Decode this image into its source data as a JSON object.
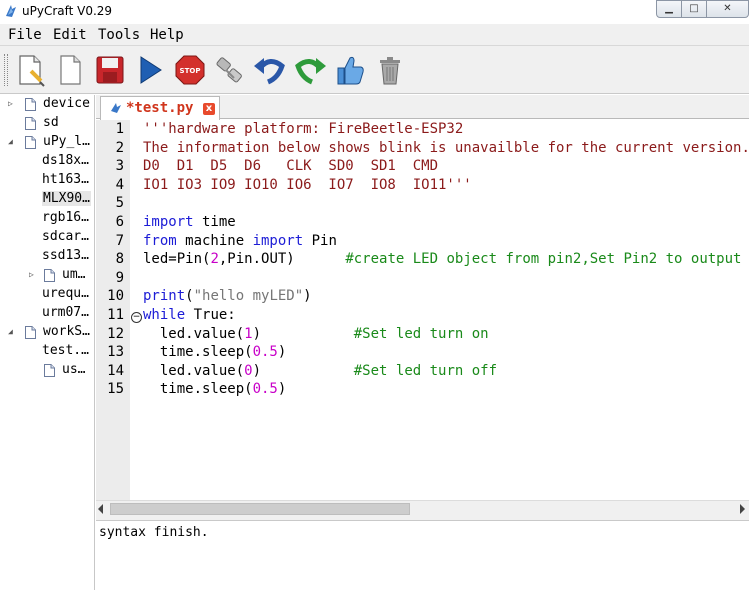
{
  "window": {
    "title": "uPyCraft V0.29",
    "controls": {
      "minimize": "▁",
      "maximize": "□",
      "close": "✕"
    }
  },
  "menu": {
    "items": [
      "File",
      "Edit",
      "Tools",
      "Help"
    ]
  },
  "toolbar": {
    "icons": [
      "new-file-icon",
      "open-file-icon",
      "save-icon",
      "run-icon",
      "stop-icon",
      "connect-icon",
      "undo-icon",
      "redo-icon",
      "syntax-check-icon",
      "clear-icon"
    ]
  },
  "tree": {
    "items": [
      {
        "label": "device",
        "has_arrow": true,
        "arrow": "▷",
        "indent": 0,
        "type": "folder"
      },
      {
        "label": "sd",
        "has_arrow": false,
        "indent": 0,
        "type": "folder"
      },
      {
        "label": "uPy_l…",
        "has_arrow": true,
        "arrow": "◢",
        "indent": 0,
        "type": "folder"
      },
      {
        "label": "ds18x…",
        "indent": 1,
        "type": "file"
      },
      {
        "label": "ht163…",
        "indent": 1,
        "type": "file"
      },
      {
        "label": "MLX90…",
        "indent": 1,
        "type": "file",
        "selected": true
      },
      {
        "label": "rgb16…",
        "indent": 1,
        "type": "file"
      },
      {
        "label": "sdcar…",
        "indent": 1,
        "type": "file"
      },
      {
        "label": "ssd13…",
        "indent": 1,
        "type": "file"
      },
      {
        "label": "um…",
        "has_arrow": true,
        "arrow": "▷",
        "indent": 1,
        "type": "folder"
      },
      {
        "label": "urequ…",
        "indent": 1,
        "type": "file"
      },
      {
        "label": "urm07…",
        "indent": 1,
        "type": "file"
      },
      {
        "label": "workS…",
        "has_arrow": true,
        "arrow": "◢",
        "indent": 0,
        "type": "folder"
      },
      {
        "label": "test.…",
        "indent": 1,
        "type": "file"
      },
      {
        "label": "us…",
        "indent": 1,
        "type": "folder"
      }
    ]
  },
  "tab": {
    "label": "*test.py",
    "close": "x"
  },
  "editor": {
    "fold_marker": "−",
    "lines": [
      {
        "n": "1",
        "parts": [
          {
            "t": "'''hardware platform: FireBeetle-ESP32",
            "c": "str"
          }
        ]
      },
      {
        "n": "2",
        "parts": [
          {
            "t": "The information below shows blink is unavailble for the current version.",
            "c": "str"
          }
        ]
      },
      {
        "n": "3",
        "parts": [
          {
            "t": "D0  D1  D5  D6   CLK  SD0  SD1  CMD",
            "c": "str"
          }
        ]
      },
      {
        "n": "4",
        "parts": [
          {
            "t": "IO1 IO3 IO9 IO10 IO6  IO7  IO8  IO11'''",
            "c": "str"
          }
        ]
      },
      {
        "n": "5",
        "parts": []
      },
      {
        "n": "6",
        "parts": [
          {
            "t": "import",
            "c": "kw"
          },
          {
            "t": " time",
            "c": ""
          }
        ]
      },
      {
        "n": "7",
        "parts": [
          {
            "t": "from",
            "c": "kw"
          },
          {
            "t": " machine ",
            "c": ""
          },
          {
            "t": "import",
            "c": "kw"
          },
          {
            "t": " Pin",
            "c": ""
          }
        ]
      },
      {
        "n": "8",
        "parts": [
          {
            "t": "led=Pin(",
            "c": ""
          },
          {
            "t": "2",
            "c": "num"
          },
          {
            "t": ",Pin.OUT)      ",
            "c": ""
          },
          {
            "t": "#create LED object from pin2,Set Pin2 to output",
            "c": "com"
          }
        ]
      },
      {
        "n": "9",
        "parts": []
      },
      {
        "n": "10",
        "parts": [
          {
            "t": "print",
            "c": "kw"
          },
          {
            "t": "(",
            "c": ""
          },
          {
            "t": "\"hello myLED\"",
            "c": "pstr"
          },
          {
            "t": ")",
            "c": ""
          }
        ]
      },
      {
        "n": "11",
        "parts": [
          {
            "t": "while",
            "c": "kw"
          },
          {
            "t": " True:",
            "c": ""
          }
        ]
      },
      {
        "n": "12",
        "parts": [
          {
            "t": "  led.value(",
            "c": ""
          },
          {
            "t": "1",
            "c": "num"
          },
          {
            "t": ")           ",
            "c": ""
          },
          {
            "t": "#Set led turn on",
            "c": "com"
          }
        ]
      },
      {
        "n": "13",
        "parts": [
          {
            "t": "  time.sleep(",
            "c": ""
          },
          {
            "t": "0.5",
            "c": "num"
          },
          {
            "t": ")",
            "c": ""
          }
        ]
      },
      {
        "n": "14",
        "parts": [
          {
            "t": "  led.value(",
            "c": ""
          },
          {
            "t": "0",
            "c": "num"
          },
          {
            "t": ")           ",
            "c": ""
          },
          {
            "t": "#Set led turn off",
            "c": "com"
          }
        ]
      },
      {
        "n": "15",
        "parts": [
          {
            "t": "  time.sleep(",
            "c": ""
          },
          {
            "t": "0.5",
            "c": "num"
          },
          {
            "t": ")",
            "c": ""
          }
        ]
      }
    ]
  },
  "console": {
    "text": "syntax finish."
  },
  "colors": {
    "string": "#8b1a1a",
    "keyword": "#1c1cd6",
    "number": "#c800c8",
    "comment": "#1a8a1a",
    "tab_label": "#d0351c"
  }
}
